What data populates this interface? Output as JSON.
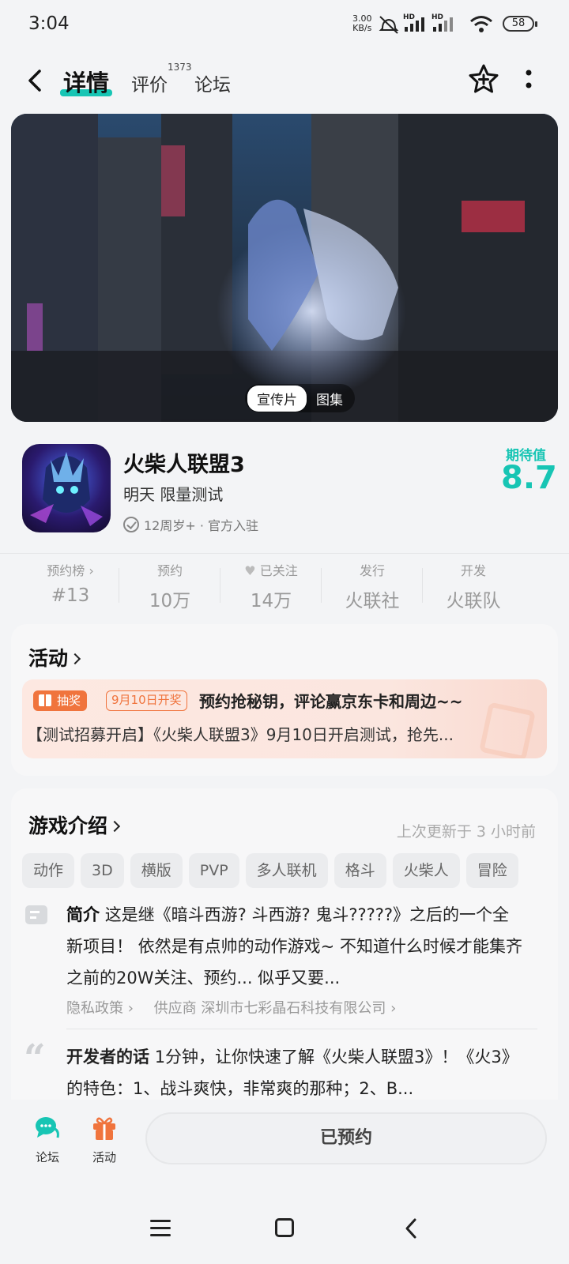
{
  "status_bar": {
    "time": "3:04",
    "net_speed_value": "3.00",
    "net_speed_unit": "KB/s",
    "signal1_label": "HD",
    "signal2_label": "HD",
    "battery": "58"
  },
  "nav": {
    "tabs": [
      {
        "label": "详情",
        "active": true
      },
      {
        "label": "评价",
        "count": "1373"
      },
      {
        "label": "论坛"
      }
    ]
  },
  "banner": {
    "media_tabs": [
      {
        "label": "宣传片",
        "active": true
      },
      {
        "label": "图集"
      }
    ]
  },
  "game": {
    "title": "火柴人联盟3",
    "subtitle": "明天 限量测试",
    "meta": "12周岁+ · 官方入驻",
    "expect_label": "期待值",
    "expect_value": "8.7"
  },
  "stats": [
    {
      "label": "预约榜 ›",
      "value": "#13"
    },
    {
      "label": "预约",
      "value": "10万"
    },
    {
      "label": "已关注",
      "value": "14万"
    },
    {
      "label": "发行",
      "value": "火联社"
    },
    {
      "label": "开发",
      "value": "火联队"
    }
  ],
  "activity": {
    "title": "活动",
    "badge": "抽奖",
    "date_tag": "9月10日开奖",
    "promo_title": "预约抢秘钥，评论赢京东卡和周边~~",
    "promo_desc": "【测试招募开启】《火柴人联盟3》9月10日开启测试，抢先..."
  },
  "intro": {
    "title": "游戏介绍",
    "updated": "上次更新于 3 小时前",
    "tags": [
      "动作",
      "3D",
      "横版",
      "PVP",
      "多人联机",
      "格斗",
      "火柴人",
      "冒险"
    ],
    "summary_label": "简介",
    "summary": "这是继《暗斗西游? 斗西游? 鬼斗?????》之后的一个全新项目！ 依然是有点帅的动作游戏~ 不知道什么时候才能集齐之前的20W关注、预约... 似乎又要...",
    "privacy_link": "隐私政策 ›",
    "supplier": "供应商  深圳市七彩晶石科技有限公司 ›",
    "dev_label": "开发者的话",
    "dev_text": "1分钟，让你快速了解《火柴人联盟3》！《火3》的特色：1、战斗爽快，非常爽的那种；2、B..."
  },
  "bottom": {
    "forum_label": "论坛",
    "activity_label": "活动",
    "reserve_button": "已预约"
  },
  "colors": {
    "accent": "#17c5b4",
    "orange": "#f0743d"
  }
}
